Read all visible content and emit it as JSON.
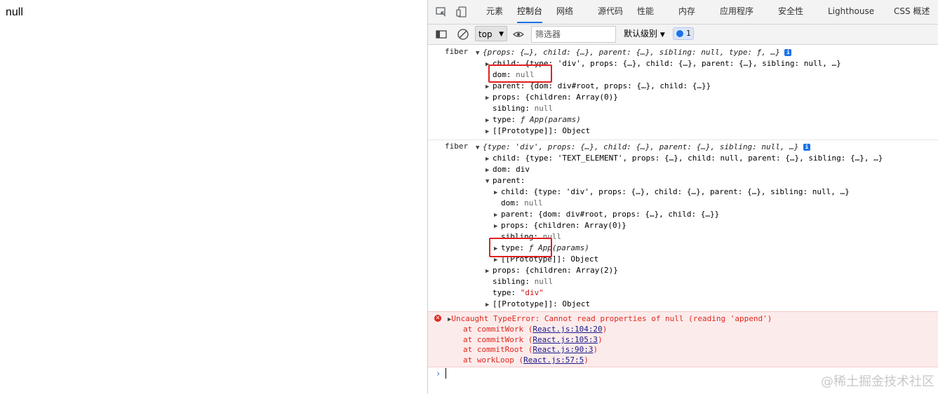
{
  "page": {
    "text": "null"
  },
  "devtools": {
    "tabs": [
      "元素",
      "控制台",
      "网络",
      "源代码",
      "性能",
      "内存",
      "应用程序",
      "安全性",
      "Lighthouse",
      "CSS 概述"
    ],
    "active_tab": "控制台",
    "toolbar": {
      "context": "top",
      "filter_placeholder": "筛选器",
      "level": "默认级别",
      "issues_count": "1"
    }
  },
  "console": {
    "log1": {
      "label": "fiber",
      "summary": "{props: {…}, child: {…}, parent: {…}, sibling: null, type: ƒ, …}",
      "rows": [
        {
          "key": "child",
          "value": "{type: 'div', props: {…}, child: {…}, parent: {…}, sibling: null, …}"
        },
        {
          "key": "dom",
          "value": "null"
        },
        {
          "key": "parent",
          "value": "{dom: div#root, props: {…}, child: {…}}"
        },
        {
          "key": "props",
          "value": "{children: Array(0)}"
        },
        {
          "key": "sibling",
          "value": "null"
        },
        {
          "key": "type",
          "value": "ƒ App(params)"
        },
        {
          "key": "[[Prototype]]",
          "value": "Object"
        }
      ]
    },
    "log2": {
      "label": "fiber",
      "summary": "{type: 'div', props: {…}, child: {…}, parent: {…}, sibling: null, …}",
      "rows": [
        {
          "key": "child",
          "value": "{type: 'TEXT_ELEMENT', props: {…}, child: null, parent: {…}, sibling: {…}, …}"
        },
        {
          "key": "dom",
          "value": "div"
        },
        {
          "key": "parent",
          "value": ""
        },
        {
          "key": "child",
          "value": "{type: 'div', props: {…}, child: {…}, parent: {…}, sibling: null, …}"
        },
        {
          "key": "dom",
          "value": "null"
        },
        {
          "key": "parent",
          "value": "{dom: div#root, props: {…}, child: {…}}"
        },
        {
          "key": "props",
          "value": "{children: Array(0)}"
        },
        {
          "key": "sibling",
          "value": "null"
        },
        {
          "key": "type",
          "value": "ƒ App(params)"
        },
        {
          "key": "[[Prototype]]",
          "value": "Object"
        },
        {
          "key": "props",
          "value": "{children: Array(2)}"
        },
        {
          "key": "sibling",
          "value": "null"
        },
        {
          "key": "type",
          "value": "\"div\""
        },
        {
          "key": "[[Prototype]]",
          "value": "Object"
        }
      ]
    },
    "error": {
      "message": "Uncaught TypeError: Cannot read properties of null (reading 'append')",
      "stack": [
        {
          "fn": "at commitWork (",
          "link": "React.js:104:20",
          "end": ")"
        },
        {
          "fn": "at commitWork (",
          "link": "React.js:105:3",
          "end": ")"
        },
        {
          "fn": "at commitRoot (",
          "link": "React.js:90:3",
          "end": ")"
        },
        {
          "fn": "at workLoop (",
          "link": "React.js:57:5",
          "end": ")"
        }
      ]
    },
    "prompt": "›"
  },
  "watermark": "@稀土掘金技术社区"
}
